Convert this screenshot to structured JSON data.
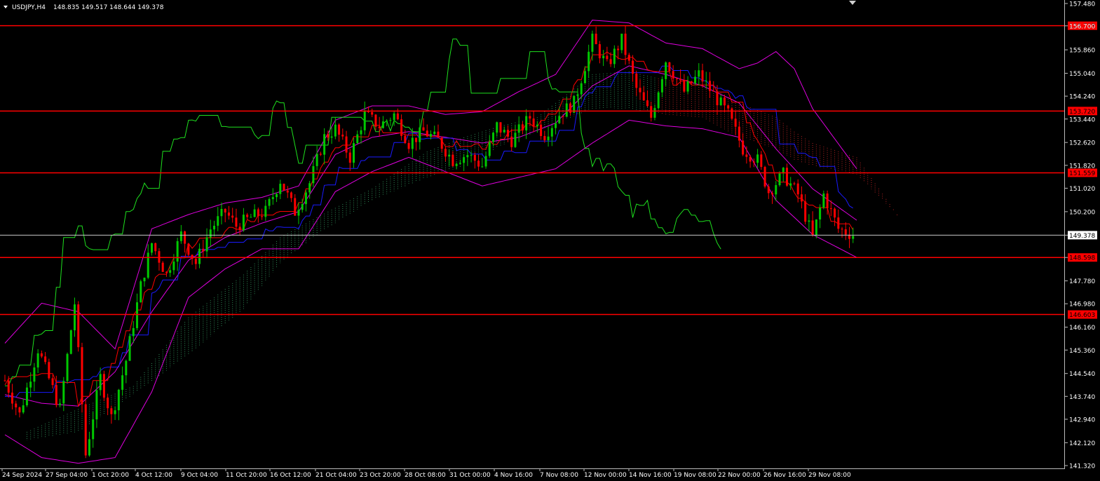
{
  "header": {
    "symbol": "USDJPY,H4",
    "ohlc": "148.835 149.517 148.644 149.378",
    "menu_icon": "triangle-down-icon"
  },
  "chart_data": {
    "type": "candlestick",
    "symbol": "USDJPY",
    "timeframe": "H4",
    "ylim": [
      141.32,
      157.48
    ],
    "y_ticks": [
      "157.480",
      "156.700",
      "155.860",
      "155.040",
      "154.240",
      "153.440",
      "152.620",
      "151.820",
      "151.020",
      "150.200",
      "149.378",
      "148.598",
      "147.780",
      "146.980",
      "146.160",
      "145.360",
      "144.540",
      "143.740",
      "142.940",
      "142.120",
      "141.320"
    ],
    "x_ticks": [
      "24 Sep 2024",
      "27 Sep 04:00",
      "1 Oct 20:00",
      "4 Oct 12:00",
      "9 Oct 04:00",
      "11 Oct 20:00",
      "16 Oct 12:00",
      "21 Oct 04:00",
      "23 Oct 20:00",
      "28 Oct 08:00",
      "31 Oct 00:00",
      "4 Nov 16:00",
      "7 Nov 08:00",
      "12 Nov 00:00",
      "14 Nov 16:00",
      "19 Nov 08:00",
      "22 Nov 00:00",
      "26 Nov 16:00",
      "29 Nov 08:00"
    ],
    "current_price": {
      "value": 149.378,
      "label": "149.378"
    },
    "horizontal_levels": [
      {
        "value": 156.703,
        "label": "156.703"
      },
      {
        "value": 153.72,
        "label": "153.720"
      },
      {
        "value": 151.559,
        "label": "151.559"
      },
      {
        "value": 148.598,
        "label": "148.598"
      },
      {
        "value": 146.603,
        "label": "146.603"
      }
    ],
    "price_path": [
      [
        0,
        144.3
      ],
      [
        4,
        143.1
      ],
      [
        9,
        145.4
      ],
      [
        15,
        143.3
      ],
      [
        19,
        147.0
      ],
      [
        22,
        141.7
      ],
      [
        26,
        144.4
      ],
      [
        29,
        143.0
      ],
      [
        33,
        145.0
      ],
      [
        37,
        147.6
      ],
      [
        40,
        149.1
      ],
      [
        44,
        148.0
      ],
      [
        48,
        149.4
      ],
      [
        52,
        148.4
      ],
      [
        56,
        149.6
      ],
      [
        60,
        150.2
      ],
      [
        63,
        149.7
      ],
      [
        67,
        150.0
      ],
      [
        71,
        150.2
      ],
      [
        75,
        151.3
      ],
      [
        79,
        150.2
      ],
      [
        83,
        151.2
      ],
      [
        87,
        152.8
      ],
      [
        90,
        153.1
      ],
      [
        94,
        152.1
      ],
      [
        98,
        153.6
      ],
      [
        102,
        153.2
      ],
      [
        106,
        153.6
      ],
      [
        110,
        152.6
      ],
      [
        114,
        153.0
      ],
      [
        118,
        152.7
      ],
      [
        122,
        152.0
      ],
      [
        126,
        152.2
      ],
      [
        130,
        151.8
      ],
      [
        134,
        153.2
      ],
      [
        138,
        152.7
      ],
      [
        143,
        153.5
      ],
      [
        147,
        152.9
      ],
      [
        151,
        153.6
      ],
      [
        155,
        154.0
      ],
      [
        160,
        156.2
      ],
      [
        164,
        155.3
      ],
      [
        168,
        156.2
      ],
      [
        172,
        154.5
      ],
      [
        176,
        153.5
      ],
      [
        180,
        155.5
      ],
      [
        185,
        154.4
      ],
      [
        189,
        155.0
      ],
      [
        193,
        154.3
      ],
      [
        197,
        153.6
      ],
      [
        201,
        152.4
      ],
      [
        205,
        152.0
      ],
      [
        208,
        150.9
      ],
      [
        212,
        151.5
      ],
      [
        216,
        150.8
      ],
      [
        220,
        149.3
      ],
      [
        223,
        150.8
      ],
      [
        227,
        149.6
      ],
      [
        231,
        149.4
      ]
    ],
    "cloud_upper": [
      [
        6,
        142.5
      ],
      [
        20,
        143.3
      ],
      [
        35,
        144.1
      ],
      [
        50,
        146.5
      ],
      [
        65,
        148.0
      ],
      [
        75,
        149.3
      ],
      [
        85,
        150.0
      ],
      [
        100,
        151.0
      ],
      [
        115,
        152.3
      ],
      [
        125,
        152.8
      ],
      [
        135,
        153.2
      ],
      [
        145,
        153.5
      ],
      [
        160,
        155.0
      ],
      [
        170,
        155.1
      ],
      [
        180,
        154.8
      ],
      [
        190,
        154.7
      ],
      [
        200,
        154.0
      ],
      [
        210,
        153.5
      ],
      [
        215,
        153.0
      ],
      [
        220,
        152.6
      ],
      [
        232,
        152.1
      ],
      [
        243,
        150.1
      ]
    ],
    "cloud_lower": [
      [
        6,
        142.2
      ],
      [
        20,
        142.5
      ],
      [
        35,
        143.8
      ],
      [
        50,
        145.2
      ],
      [
        65,
        146.8
      ],
      [
        75,
        148.4
      ],
      [
        85,
        149.4
      ],
      [
        100,
        150.6
      ],
      [
        115,
        151.4
      ],
      [
        125,
        151.8
      ],
      [
        135,
        152.5
      ],
      [
        145,
        153.0
      ],
      [
        160,
        153.8
      ],
      [
        170,
        153.8
      ],
      [
        180,
        153.6
      ],
      [
        190,
        153.5
      ],
      [
        200,
        152.8
      ],
      [
        210,
        152.4
      ],
      [
        215,
        152.0
      ],
      [
        220,
        151.8
      ],
      [
        232,
        151.5
      ],
      [
        243,
        150.1
      ]
    ],
    "tenkan_sen": [
      [
        0,
        144.2
      ],
      [
        10,
        144.6
      ],
      [
        20,
        143.5
      ],
      [
        30,
        145.2
      ],
      [
        40,
        147.8
      ],
      [
        50,
        149.0
      ],
      [
        60,
        149.5
      ],
      [
        70,
        150.0
      ],
      [
        80,
        150.5
      ],
      [
        90,
        152.5
      ],
      [
        100,
        153.1
      ],
      [
        110,
        152.9
      ],
      [
        120,
        152.6
      ],
      [
        130,
        152.5
      ],
      [
        140,
        153.1
      ],
      [
        150,
        153.6
      ],
      [
        160,
        155.8
      ],
      [
        170,
        155.5
      ],
      [
        180,
        154.8
      ],
      [
        190,
        154.6
      ],
      [
        200,
        153.8
      ],
      [
        210,
        151.4
      ],
      [
        220,
        150.4
      ],
      [
        231,
        149.5
      ]
    ],
    "kijun_sen": [
      [
        0,
        143.6
      ],
      [
        10,
        144.3
      ],
      [
        20,
        144.3
      ],
      [
        30,
        144.8
      ],
      [
        40,
        147.3
      ],
      [
        50,
        148.9
      ],
      [
        60,
        149.0
      ],
      [
        70,
        149.5
      ],
      [
        80,
        149.7
      ],
      [
        90,
        151.6
      ],
      [
        100,
        152.2
      ],
      [
        110,
        152.9
      ],
      [
        120,
        152.6
      ],
      [
        130,
        152.0
      ],
      [
        140,
        152.4
      ],
      [
        150,
        153.0
      ],
      [
        160,
        154.4
      ],
      [
        170,
        155.3
      ],
      [
        180,
        155.3
      ],
      [
        190,
        154.8
      ],
      [
        200,
        154.2
      ],
      [
        210,
        152.7
      ],
      [
        220,
        152.0
      ],
      [
        231,
        150.3
      ]
    ],
    "chikou_span": [
      [
        0,
        143.8
      ],
      [
        6,
        145.6
      ],
      [
        13,
        146.4
      ],
      [
        15,
        149.1
      ],
      [
        20,
        149.5
      ],
      [
        25,
        148.6
      ],
      [
        30,
        149.6
      ],
      [
        35,
        150.4
      ],
      [
        40,
        151.4
      ],
      [
        45,
        152.6
      ],
      [
        50,
        153.3
      ],
      [
        55,
        153.6
      ],
      [
        60,
        153.0
      ],
      [
        65,
        152.8
      ],
      [
        70,
        153.0
      ],
      [
        75,
        154.1
      ],
      [
        80,
        152.1
      ],
      [
        85,
        153.3
      ],
      [
        90,
        153.6
      ],
      [
        95,
        154.0
      ],
      [
        100,
        152.8
      ],
      [
        105,
        153.2
      ],
      [
        110,
        153.0
      ],
      [
        115,
        153.9
      ],
      [
        120,
        155.3
      ],
      [
        123,
        156.5
      ],
      [
        126,
        154.6
      ],
      [
        130,
        154.3
      ],
      [
        135,
        154.9
      ],
      [
        140,
        155.7
      ],
      [
        145,
        155.8
      ],
      [
        150,
        154.3
      ],
      [
        155,
        153.6
      ],
      [
        160,
        151.8
      ],
      [
        165,
        151.9
      ],
      [
        170,
        150.2
      ],
      [
        175,
        150.4
      ],
      [
        180,
        149.3
      ],
      [
        185,
        150.1
      ],
      [
        190,
        149.9
      ],
      [
        195,
        148.9
      ]
    ],
    "bollinger_upper": [
      [
        0,
        145.6
      ],
      [
        10,
        147.0
      ],
      [
        20,
        146.7
      ],
      [
        30,
        145.4
      ],
      [
        40,
        149.6
      ],
      [
        50,
        150.1
      ],
      [
        60,
        150.5
      ],
      [
        70,
        150.7
      ],
      [
        80,
        151.1
      ],
      [
        90,
        153.4
      ],
      [
        100,
        153.9
      ],
      [
        110,
        153.9
      ],
      [
        120,
        153.6
      ],
      [
        130,
        153.7
      ],
      [
        140,
        154.4
      ],
      [
        150,
        155.0
      ],
      [
        160,
        156.9
      ],
      [
        170,
        156.8
      ],
      [
        180,
        156.1
      ],
      [
        190,
        155.9
      ],
      [
        200,
        155.2
      ],
      [
        205,
        155.4
      ],
      [
        210,
        155.8
      ],
      [
        215,
        155.2
      ],
      [
        220,
        153.8
      ],
      [
        232,
        151.7
      ]
    ],
    "bollinger_mid": [
      [
        0,
        143.8
      ],
      [
        10,
        143.5
      ],
      [
        20,
        143.4
      ],
      [
        30,
        144.6
      ],
      [
        40,
        146.7
      ],
      [
        50,
        148.5
      ],
      [
        60,
        149.3
      ],
      [
        70,
        149.8
      ],
      [
        80,
        150.2
      ],
      [
        90,
        152.2
      ],
      [
        100,
        152.8
      ],
      [
        110,
        153.0
      ],
      [
        120,
        152.8
      ],
      [
        130,
        152.6
      ],
      [
        140,
        152.8
      ],
      [
        150,
        153.3
      ],
      [
        160,
        154.6
      ],
      [
        170,
        155.3
      ],
      [
        180,
        155.0
      ],
      [
        190,
        154.6
      ],
      [
        200,
        154.0
      ],
      [
        210,
        152.4
      ],
      [
        220,
        151.0
      ],
      [
        232,
        149.9
      ]
    ],
    "bollinger_lower": [
      [
        0,
        142.4
      ],
      [
        10,
        141.6
      ],
      [
        20,
        141.4
      ],
      [
        30,
        141.6
      ],
      [
        40,
        143.9
      ],
      [
        50,
        147.2
      ],
      [
        60,
        148.2
      ],
      [
        70,
        148.9
      ],
      [
        80,
        148.9
      ],
      [
        90,
        150.9
      ],
      [
        100,
        151.6
      ],
      [
        110,
        152.1
      ],
      [
        120,
        151.6
      ],
      [
        130,
        151.1
      ],
      [
        140,
        151.4
      ],
      [
        150,
        151.7
      ],
      [
        160,
        152.6
      ],
      [
        170,
        153.4
      ],
      [
        180,
        153.2
      ],
      [
        190,
        153.1
      ],
      [
        200,
        152.8
      ],
      [
        210,
        150.6
      ],
      [
        220,
        149.4
      ],
      [
        232,
        148.6
      ]
    ],
    "colors": {
      "background": "#000000",
      "up_candle": "#00c800",
      "down_candle": "#ff0000",
      "level_line": "#ff0000",
      "current_price_line": "#c8c8c8",
      "tenkan_sen": "#ff0000",
      "kijun_sen": "#1a1aff",
      "chikou_span": "#1ee01e",
      "bollinger": "#e000e0",
      "cloud_bull": "#2e8b57",
      "cloud_bear": "#b22222",
      "axis_text": "#ffffff"
    }
  }
}
